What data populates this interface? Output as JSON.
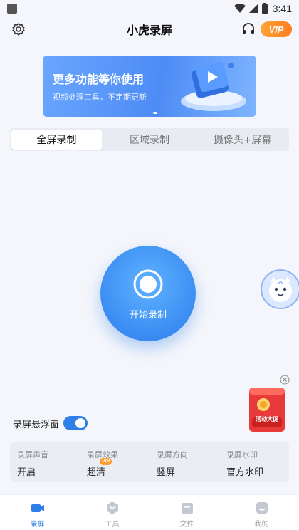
{
  "status_bar": {
    "time": "3:41"
  },
  "header": {
    "title": "小虎录屏",
    "vip_label": "VIP"
  },
  "banner": {
    "title": "更多功能等你使用",
    "subtitle": "视频处理工具，不定期更新"
  },
  "tabs": [
    {
      "label": "全屏录制",
      "active": true
    },
    {
      "label": "区域录制",
      "active": false
    },
    {
      "label": "摄像头+屏幕",
      "active": false
    }
  ],
  "record": {
    "label": "开始录制"
  },
  "float_window": {
    "label": "录屏悬浮窗",
    "enabled": true
  },
  "ad": {
    "label": "活动大促"
  },
  "settings": [
    {
      "label": "录屏声音",
      "value": "开启"
    },
    {
      "label": "录屏效果",
      "value": "超清",
      "badge": "VIP"
    },
    {
      "label": "录屏方向",
      "value": "竖屏"
    },
    {
      "label": "录屏水印",
      "value": "官方水印"
    }
  ],
  "bottom_nav": [
    {
      "label": "录屏",
      "icon": "camera-icon",
      "active": true
    },
    {
      "label": "工具",
      "icon": "toolbox-icon",
      "active": false
    },
    {
      "label": "文件",
      "icon": "folder-icon",
      "active": false
    },
    {
      "label": "我的",
      "icon": "profile-icon",
      "active": false
    }
  ],
  "colors": {
    "accent": "#2f7fe8",
    "vip": "#ff8a24",
    "background": "#f4f6fb"
  }
}
